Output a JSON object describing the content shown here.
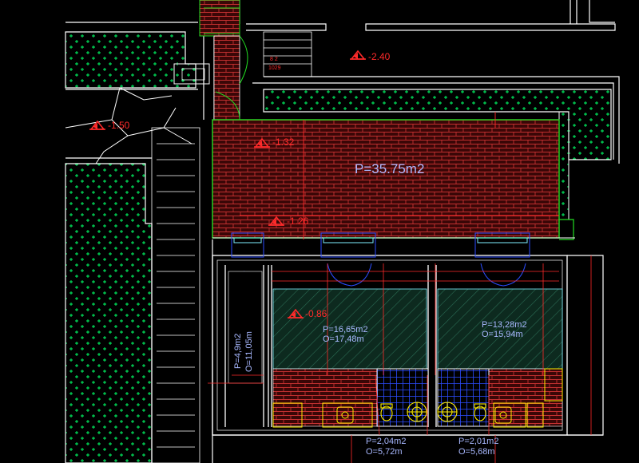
{
  "colors": {
    "background": "#000000",
    "wall": "#ffffff",
    "hedge": "#00ff66",
    "brick": "#7a0f0f",
    "brick_line": "#d23a3a",
    "red": "#ff2a2a",
    "label_blue": "#a8b8ff",
    "cyan": "#7ff0ff",
    "yellow": "#ffee00",
    "blue": "#2b4cff",
    "green_line": "#22dd22"
  },
  "elevations": {
    "e1": "-2.40",
    "e2": "-1.50",
    "e3": "-1.32",
    "e4": "-1.26",
    "e5": "-0.86"
  },
  "areas": {
    "terrace": "P=35.75m2",
    "room1_p": "P=16,65m2",
    "room1_o": "O=17,48m",
    "room2_p": "P=13,28m2",
    "room2_o": "O=15,94m",
    "corridor_p": "P=4,9m2",
    "corridor_o": "O=11,05m",
    "bath1_p": "P=2,04m2",
    "bath1_o": "O=5,72m",
    "bath2_p": "P=2,01m2",
    "bath2_o": "O=5,68m"
  },
  "stair_note": {
    "line1": "8 2",
    "line2": "1029"
  },
  "icons": {
    "elevation_marker": "elevation-marker-icon",
    "toilet": "toilet-icon",
    "shower": "shower-icon",
    "sink": "sink-icon"
  }
}
